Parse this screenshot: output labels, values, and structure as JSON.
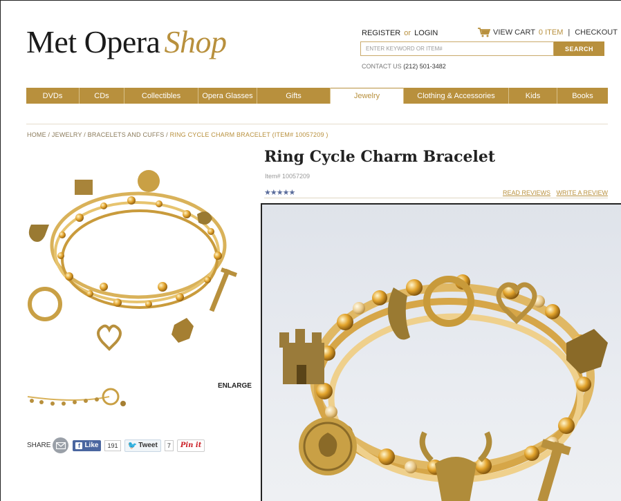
{
  "header": {
    "logo_main": "Met Opera",
    "logo_accent": "Shop",
    "register": "REGISTER",
    "or": "or",
    "login": "LOGIN",
    "view_cart": "VIEW CART",
    "cart_count": "0 ITEM",
    "checkout": "CHECKOUT",
    "search_placeholder": "ENTER KEYWORD OR ITEM#",
    "search_button": "SEARCH",
    "contact_label": "CONTACT US",
    "contact_phone": "(212) 501-3482"
  },
  "nav": {
    "active": "Jewelry",
    "tabs": [
      {
        "label": "DVDs"
      },
      {
        "label": "CDs"
      },
      {
        "label": "Collectibles"
      },
      {
        "label": "Opera Glasses"
      },
      {
        "label": "Gifts"
      },
      {
        "label": "Jewelry"
      },
      {
        "label": "Clothing & Accessories"
      },
      {
        "label": "Kids"
      },
      {
        "label": "Books"
      }
    ]
  },
  "breadcrumb": {
    "home": "HOME",
    "jewelry": "JEWELRY",
    "category": "BRACELETS AND CUFFS",
    "current": "RING CYCLE CHARM BRACELET (ITEM# 10057209 )"
  },
  "product": {
    "title": "Ring Cycle Charm Bracelet",
    "item_number": "Item# 10057209",
    "stars": "★★★★★",
    "rating": 5,
    "read_reviews": "READ REVIEWS",
    "write_review": "WRITE A REVIEW",
    "enlarge": "ENLARGE"
  },
  "share": {
    "label": "SHARE",
    "like": "Like",
    "like_count": "191",
    "tweet": "Tweet",
    "tweet_count": "7",
    "pin": "Pin it"
  },
  "colors": {
    "accent": "#b8903d",
    "stars": "#5a6c9b",
    "facebook": "#4a66a0",
    "pinterest": "#cb2027"
  }
}
